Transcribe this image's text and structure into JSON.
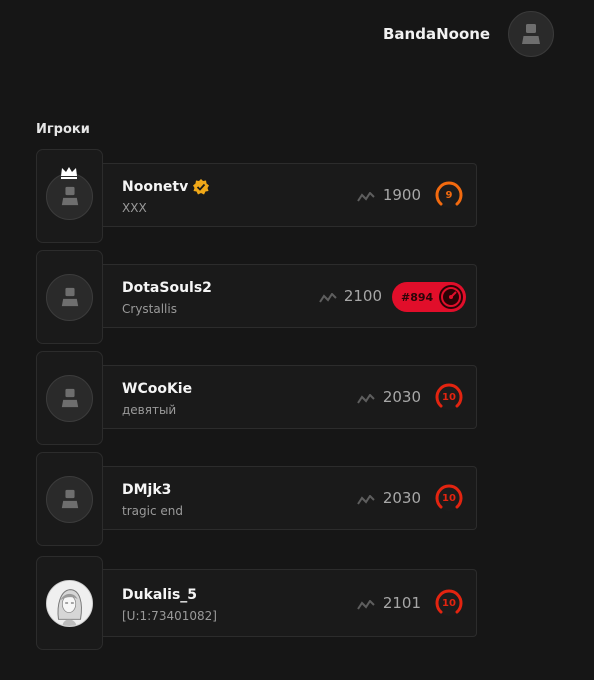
{
  "header": {
    "username": "BandaNoone"
  },
  "section_title": "Игроки",
  "players": [
    {
      "name": "Noonetv",
      "desc": "XXX",
      "mmr": "1900",
      "rank": "9",
      "rank_color": "#f26a0f",
      "crown": true,
      "verified": true
    },
    {
      "name": "DotaSouls2",
      "desc": "Crystallis",
      "mmr": "2100",
      "leaderboard": "#894",
      "rank_color": "#e10e2a"
    },
    {
      "name": "WCooKie",
      "desc": "девятый",
      "mmr": "2030",
      "rank": "10",
      "rank_color": "#e32410"
    },
    {
      "name": "DMjk3",
      "desc": "tragic end",
      "mmr": "2030",
      "rank": "10",
      "rank_color": "#e32410"
    },
    {
      "name": "Dukalis_5",
      "desc": "[U:1:73401082]",
      "mmr": "2101",
      "rank": "10",
      "rank_color": "#e32410",
      "custom_avatar": true
    }
  ]
}
